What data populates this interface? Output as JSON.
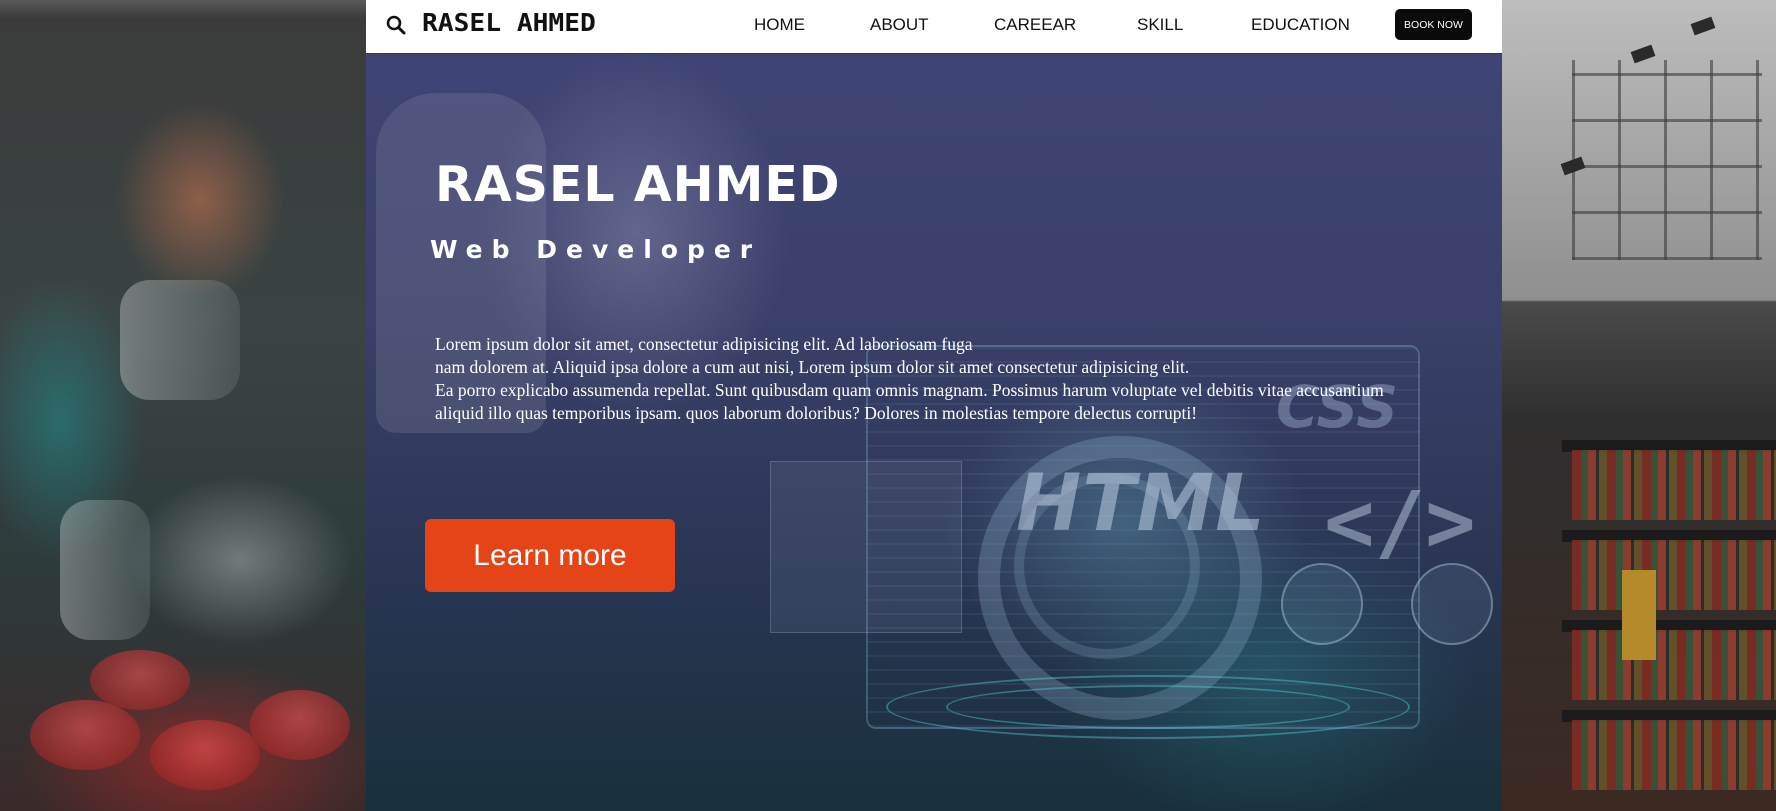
{
  "navbar": {
    "brand": "RASEL AHMED",
    "items": [
      {
        "label": "HOME"
      },
      {
        "label": "ABOUT"
      },
      {
        "label": "CAREEAR"
      },
      {
        "label": "SKILL"
      },
      {
        "label": "EDUCATION"
      }
    ],
    "cta_label": "BOOK NOW"
  },
  "hero": {
    "title": "RASEL AHMED",
    "subtitle": "Web Developer",
    "description_lines": [
      "Lorem ipsum dolor sit amet, consectetur adipisicing elit. Ad laboriosam fuga",
      "nam dolorem at. Aliquid ipsa dolore a cum aut nisi, Lorem ipsum dolor sit amet consectetur adipisicing elit.",
      "Ea porro explicabo assumenda repellat. Sunt quibusdam quam omnis magnam. Possimus harum voluptate vel debitis vitae accusantium",
      "aliquid illo quas temporibus ipsam. quos laborum doloribus? Dolores in molestias tempore delectus corrupti!"
    ],
    "button_label": "Learn more",
    "bg_words": {
      "html": "HTML",
      "css": "CSS",
      "tag": "</>"
    }
  },
  "colors": {
    "accent": "#e54416",
    "navbar_bg": "#ffffff",
    "book_button_bg": "#0a0a0a"
  },
  "icons": {
    "search": "search-icon"
  }
}
